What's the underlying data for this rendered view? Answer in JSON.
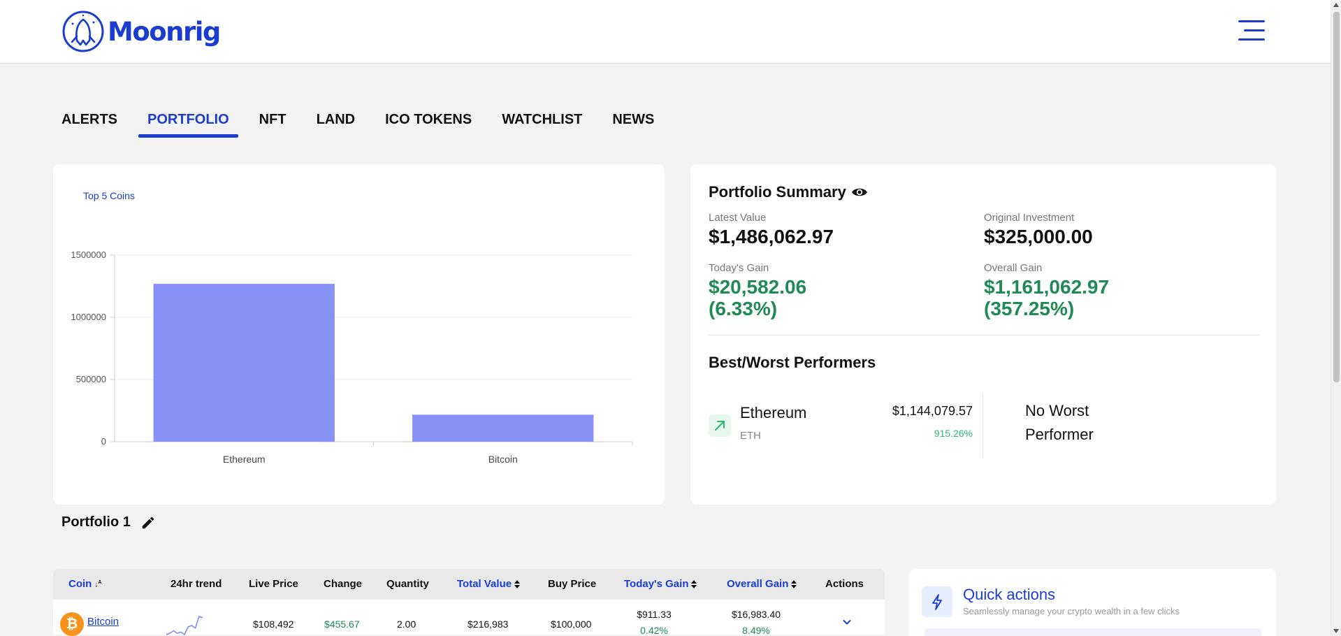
{
  "app": {
    "name": "Moonrig"
  },
  "header": {
    "logo_icon": "moonrig-logo-icon",
    "menu_icon": "hamburger-menu-icon"
  },
  "tabs": [
    {
      "label": "ALERTS",
      "active": false
    },
    {
      "label": "PORTFOLIO",
      "active": true
    },
    {
      "label": "NFT",
      "active": false
    },
    {
      "label": "LAND",
      "active": false
    },
    {
      "label": "ICO TOKENS",
      "active": false
    },
    {
      "label": "WATCHLIST",
      "active": false
    },
    {
      "label": "NEWS",
      "active": false
    }
  ],
  "chart_data": {
    "type": "bar",
    "title": "",
    "legend": [
      "Top 5 Coins"
    ],
    "categories": [
      "Ethereum",
      "Bitcoin"
    ],
    "series": [
      {
        "name": "Top 5 Coins",
        "values": [
          1269000,
          217000
        ]
      }
    ],
    "yticks": [
      "0",
      "500000",
      "1000000",
      "1500000"
    ],
    "ylim": [
      0,
      1500000
    ],
    "color": "#8891f6",
    "grid": true
  },
  "summary": {
    "title": "Portfolio Summary",
    "eye_icon": "eye-icon",
    "latest_value_label": "Latest Value",
    "latest_value": "$1,486,062.97",
    "original_investment_label": "Original Investment",
    "original_investment": "$325,000.00",
    "todays_gain_label": "Today's Gain",
    "todays_gain_value": "$20,582.06",
    "todays_gain_pct": "(6.33%)",
    "overall_gain_label": "Overall Gain",
    "overall_gain_value": "$1,161,062.97",
    "overall_gain_pct": "(357.25%)"
  },
  "performers": {
    "title": "Best/Worst Performers",
    "best": {
      "icon": "arrow-up-right-icon",
      "name": "Ethereum",
      "symbol": "ETH",
      "value": "$1,144,079.57",
      "pct": "915.26%"
    },
    "worst_text": "No Worst Performer"
  },
  "portfolio": {
    "title": "Portfolio 1",
    "edit_icon": "pencil-icon"
  },
  "table": {
    "headers": {
      "coin": "Coin",
      "trend": "24hr trend",
      "live_price": "Live Price",
      "change": "Change",
      "quantity": "Quantity",
      "total_value": "Total Value",
      "buy_price": "Buy Price",
      "todays_gain": "Today's Gain",
      "overall_gain": "Overall Gain",
      "actions": "Actions"
    },
    "rows": [
      {
        "coin_icon": "bitcoin-icon",
        "coin_symbol": "₿",
        "coin": "Bitcoin",
        "trend": [
          2,
          3,
          5,
          3,
          4,
          2,
          8,
          9,
          7,
          16,
          15
        ],
        "live_price": "$108,492",
        "change": "$455.67",
        "quantity": "2.00",
        "total_value": "$216,983",
        "buy_price": "$100,000",
        "todays_gain": "$911.33",
        "todays_gain_pct": "0.42%",
        "overall_gain": "$16,983.40",
        "overall_gain_pct": "8.49%",
        "action_icon": "chevron-down-icon"
      }
    ]
  },
  "quick_actions": {
    "icon": "lightning-icon",
    "title": "Quick actions",
    "subtitle": "Seamlessly manage your crypto wealth in a few clicks"
  }
}
